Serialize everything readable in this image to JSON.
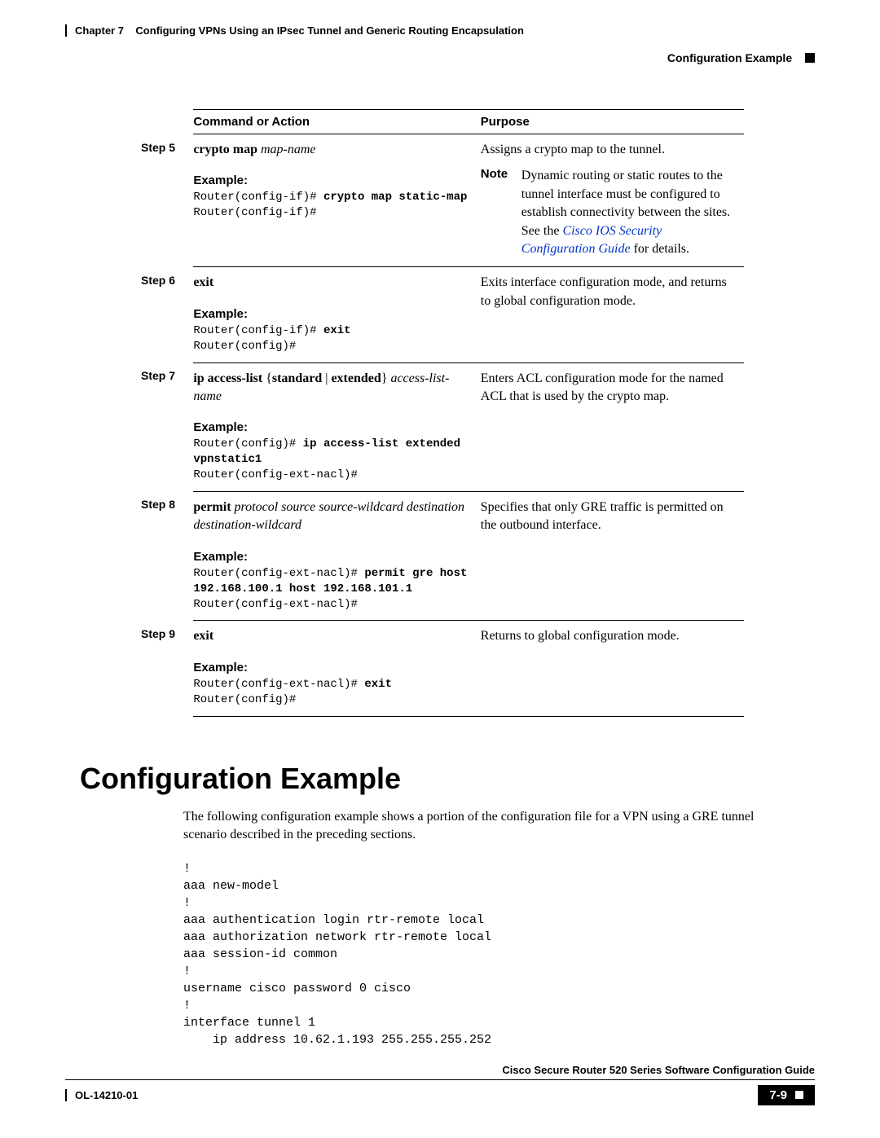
{
  "header": {
    "chapter_label": "Chapter 7",
    "chapter_title": "Configuring VPNs Using an IPsec Tunnel and Generic Routing Encapsulation",
    "section_right": "Configuration Example"
  },
  "table": {
    "col1": "Command or Action",
    "col2": "Purpose"
  },
  "steps": {
    "s5": {
      "label": "Step 5",
      "cmd_bold": "crypto map",
      "cmd_italic": " map-name",
      "example_label": "Example:",
      "code_line1a": "Router(config-if)# ",
      "code_line1b": "crypto map static-map",
      "code_line2": "Router(config-if)#",
      "purpose": "Assigns a crypto map to the tunnel.",
      "note_label": "Note",
      "note_body1": "Dynamic routing or static routes to the tunnel interface must be configured to establish connectivity between the sites. See the ",
      "note_link": "Cisco IOS Security Configuration Guide",
      "note_body2": " for details."
    },
    "s6": {
      "label": "Step 6",
      "cmd_bold": "exit",
      "example_label": "Example:",
      "code_line1a": "Router(config-if)# ",
      "code_line1b": "exit",
      "code_line2": "Router(config)#",
      "purpose": "Exits interface configuration mode, and returns to global configuration mode."
    },
    "s7": {
      "label": "Step 7",
      "cmd_bold": "ip access-list",
      "cmd_plain": " {",
      "cmd_bold2": "standard",
      "cmd_plain2": " | ",
      "cmd_bold3": "extended",
      "cmd_plain3": "} ",
      "cmd_italic": "access-list-name",
      "example_label": "Example:",
      "code_line1a": "Router(config)# ",
      "code_line1b": "ip access-list extended ",
      "code_line1c": "vpnstatic1",
      "code_line2": "Router(config-ext-nacl)#",
      "purpose": "Enters ACL configuration mode for the named ACL that is used by the crypto map."
    },
    "s8": {
      "label": "Step 8",
      "cmd_bold": "permit",
      "cmd_italic": " protocol source source-wildcard destination destination-wildcard",
      "example_label": "Example:",
      "code_line1a": "Router(config-ext-nacl)# ",
      "code_line1b": "permit gre host ",
      "code_line1c": "192.168.100.1 host 192.168.101.1",
      "code_line2": "Router(config-ext-nacl)#",
      "purpose": "Specifies that only GRE traffic is permitted on the outbound interface."
    },
    "s9": {
      "label": "Step 9",
      "cmd_bold": "exit",
      "example_label": "Example:",
      "code_line1a": "Router(config-ext-nacl)# ",
      "code_line1b": "exit",
      "code_line2": "Router(config)#",
      "purpose": "Returns to global configuration mode."
    }
  },
  "section_heading": "Configuration Example",
  "body_para": "The following configuration example shows a portion of the configuration file for a VPN using a GRE tunnel scenario described in the preceding sections.",
  "config_code": "!\naaa new-model\n!\naaa authentication login rtr-remote local\naaa authorization network rtr-remote local\naaa session-id common\n!\nusername cisco password 0 cisco\n!\ninterface tunnel 1\n    ip address 10.62.1.193 255.255.255.252",
  "footer": {
    "book_title": "Cisco Secure Router 520 Series Software Configuration Guide",
    "doc_id": "OL-14210-01",
    "page_num": "7-9"
  }
}
